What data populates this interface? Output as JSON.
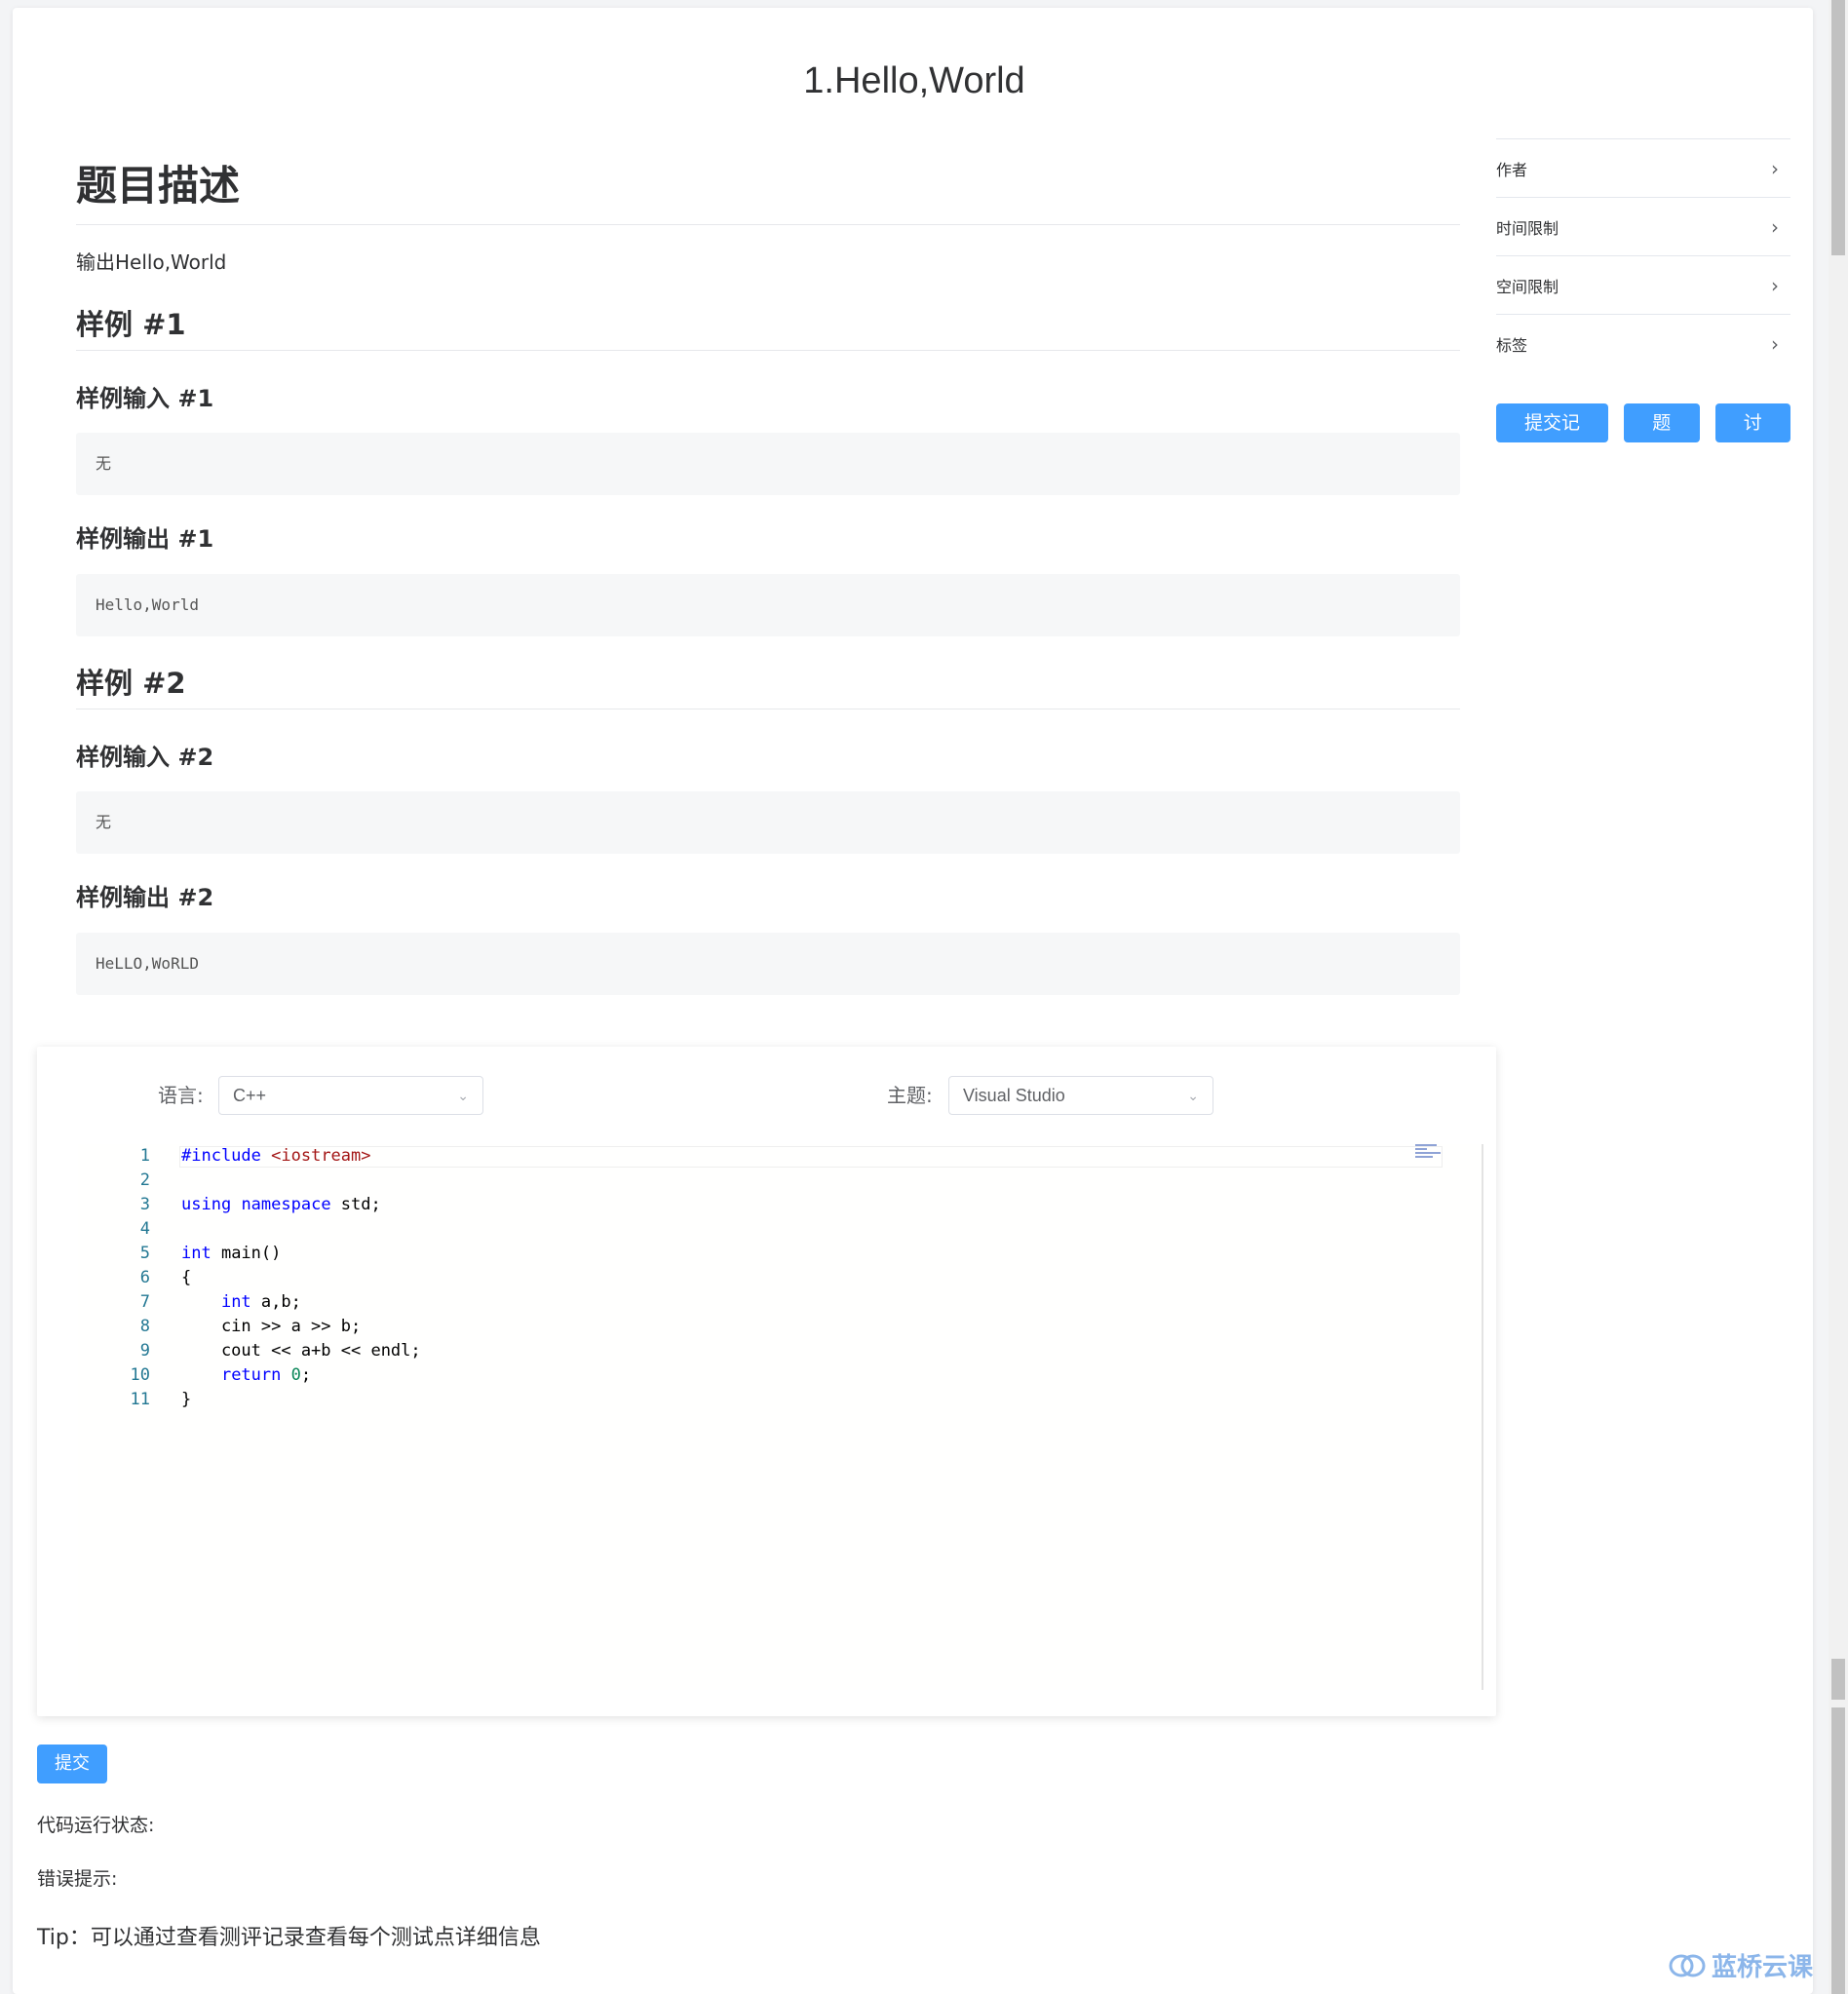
{
  "page_title": "1.Hello,World",
  "description": {
    "heading": "题目描述",
    "text": "输出Hello,World"
  },
  "samples": [
    {
      "heading": "样例 #1",
      "input_label": "样例输入 #1",
      "input": "无",
      "output_label": "样例输出 #1",
      "output": "Hello,World"
    },
    {
      "heading": "样例 #2",
      "input_label": "样例输入 #2",
      "input": "无",
      "output_label": "样例输出 #2",
      "output": "HeLLO,WoRLD"
    }
  ],
  "sidebar": {
    "items": [
      {
        "label": "作者",
        "icon": "chevron-right-icon"
      },
      {
        "label": "时间限制",
        "icon": "chevron-right-icon"
      },
      {
        "label": "空间限制",
        "icon": "chevron-right-icon"
      },
      {
        "label": "标签",
        "icon": "chevron-right-icon"
      }
    ],
    "buttons": {
      "records": "提交记录",
      "solution": "题解",
      "discuss": "讨论"
    }
  },
  "editor": {
    "language_label": "语言:",
    "language_value": "C++",
    "theme_label": "主题:",
    "theme_value": "Visual Studio",
    "line_numbers": [
      "1",
      "2",
      "3",
      "4",
      "5",
      "6",
      "7",
      "8",
      "9",
      "10",
      "11"
    ]
  },
  "submit_label": "提交",
  "run_status_label": "代码运行状态:",
  "error_label": "错误提示:",
  "tip": "Tip：可以通过查看测评记录查看每个测试点详细信息",
  "watermark": "蓝桥云课",
  "colors": {
    "primary": "#409eff",
    "keyword": "#0000ff",
    "string": "#a31515",
    "number": "#098658",
    "line_number": "#237893"
  }
}
